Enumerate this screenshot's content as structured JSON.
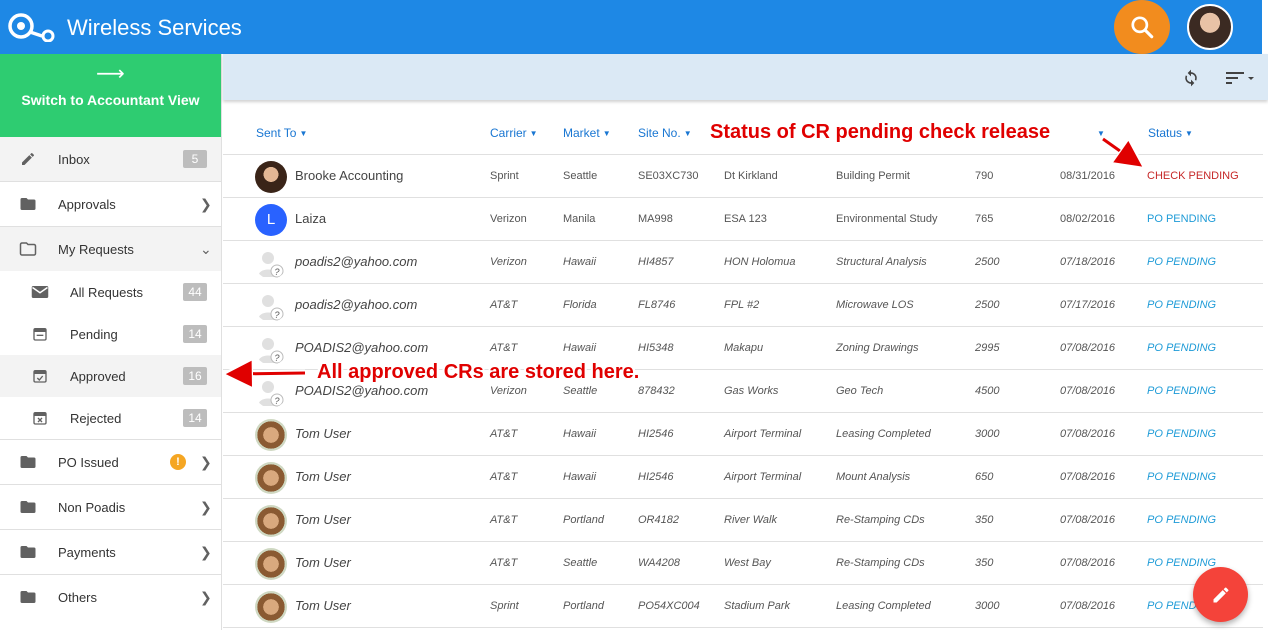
{
  "app": {
    "title": "Wireless Services"
  },
  "sidebar": {
    "switch_arrow": "⟶",
    "switch_label": "Switch to Accountant View",
    "inbox": {
      "label": "Inbox",
      "count": "5"
    },
    "approvals": {
      "label": "Approvals"
    },
    "my_requests": {
      "label": "My Requests",
      "items": [
        {
          "label": "All Requests",
          "count": "44"
        },
        {
          "label": "Pending",
          "count": "14"
        },
        {
          "label": "Approved",
          "count": "16"
        },
        {
          "label": "Rejected",
          "count": "14"
        }
      ]
    },
    "po_issued": {
      "label": "PO Issued",
      "badge": "!"
    },
    "non_poadis": {
      "label": "Non Poadis"
    },
    "payments": {
      "label": "Payments"
    },
    "others": {
      "label": "Others"
    }
  },
  "table": {
    "headers": {
      "sent_to": "Sent To",
      "carrier": "Carrier",
      "market": "Market",
      "site_no": "Site No.",
      "status": "Status"
    },
    "rows": [
      {
        "avatar": "brooke",
        "name": "Brooke Accounting",
        "carrier": "Sprint",
        "market": "Seattle",
        "site": "SE03XC730",
        "site_name": "Dt Kirkland",
        "type": "Building Permit",
        "amount": "790",
        "date": "08/31/2016",
        "status": "CHECK PENDING"
      },
      {
        "avatar": "letter",
        "letter": "L",
        "name": "Laiza",
        "carrier": "Verizon",
        "market": "Manila",
        "site": "MA998",
        "site_name": "ESA 123",
        "type": "Environmental Study",
        "amount": "765",
        "date": "08/02/2016",
        "status": "PO PENDING"
      },
      {
        "avatar": "placeholder",
        "name": "poadis2@yahoo.com",
        "carrier": "Verizon",
        "market": "Hawaii",
        "site": "HI4857",
        "site_name": "HON Holomua",
        "type": "Structural Analysis",
        "amount": "2500",
        "date": "07/18/2016",
        "status": "PO PENDING"
      },
      {
        "avatar": "placeholder",
        "name": "poadis2@yahoo.com",
        "carrier": "AT&T",
        "market": "Florida",
        "site": "FL8746",
        "site_name": "FPL #2",
        "type": "Microwave LOS",
        "amount": "2500",
        "date": "07/17/2016",
        "status": "PO PENDING"
      },
      {
        "avatar": "placeholder",
        "name": "POADIS2@yahoo.com",
        "carrier": "AT&T",
        "market": "Hawaii",
        "site": "HI5348",
        "site_name": "Makapu",
        "type": "Zoning Drawings",
        "amount": "2995",
        "date": "07/08/2016",
        "status": "PO PENDING"
      },
      {
        "avatar": "placeholder",
        "name": "POADIS2@yahoo.com",
        "carrier": "Verizon",
        "market": "Seattle",
        "site": "878432",
        "site_name": "Gas Works",
        "type": "Geo Tech",
        "amount": "4500",
        "date": "07/08/2016",
        "status": "PO PENDING"
      },
      {
        "avatar": "tom",
        "name": "Tom User",
        "carrier": "AT&T",
        "market": "Hawaii",
        "site": "HI2546",
        "site_name": "Airport Terminal",
        "type": "Leasing Completed",
        "amount": "3000",
        "date": "07/08/2016",
        "status": "PO PENDING"
      },
      {
        "avatar": "tom",
        "name": "Tom User",
        "carrier": "AT&T",
        "market": "Hawaii",
        "site": "HI2546",
        "site_name": "Airport Terminal",
        "type": "Mount Analysis",
        "amount": "650",
        "date": "07/08/2016",
        "status": "PO PENDING"
      },
      {
        "avatar": "tom",
        "name": "Tom User",
        "carrier": "AT&T",
        "market": "Portland",
        "site": "OR4182",
        "site_name": "River Walk",
        "type": "Re-Stamping CDs",
        "amount": "350",
        "date": "07/08/2016",
        "status": "PO PENDING"
      },
      {
        "avatar": "tom",
        "name": "Tom User",
        "carrier": "AT&T",
        "market": "Seattle",
        "site": "WA4208",
        "site_name": "West Bay",
        "type": "Re-Stamping CDs",
        "amount": "350",
        "date": "07/08/2016",
        "status": "PO PENDING"
      },
      {
        "avatar": "tom",
        "name": "Tom User",
        "carrier": "Sprint",
        "market": "Portland",
        "site": "PO54XC004",
        "site_name": "Stadium Park",
        "type": "Leasing Completed",
        "amount": "3000",
        "date": "07/08/2016",
        "status": "PO PENDING"
      }
    ]
  },
  "annotations": {
    "status_note": "Status of CR pending check release",
    "approved_note": "All approved CRs are stored here."
  },
  "colors": {
    "topbar": "#1e88e5",
    "switch_view": "#2ecc71",
    "search_button": "#f28c1e",
    "fab": "#f4433a",
    "check_pending": "#c62828",
    "po_pending": "#1e9bd7",
    "annotation": "#e00000"
  },
  "icons": {
    "logo": "wireless-logo-icon",
    "search": "search-icon",
    "refresh": "refresh-icon",
    "sort": "sort-icon",
    "edit": "pencil-icon"
  }
}
